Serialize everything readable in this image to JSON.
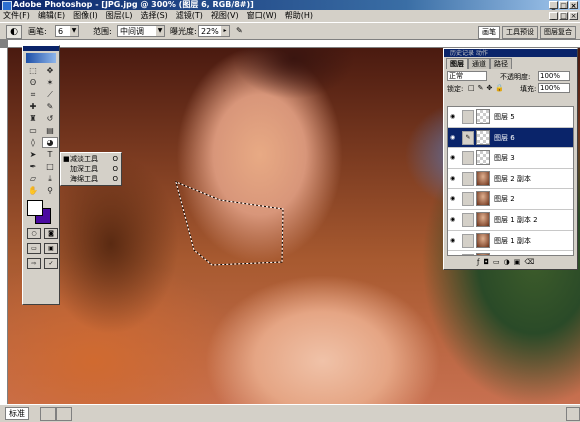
{
  "window": {
    "title": "Adobe Photoshop - [JPG.jpg @ 300% (图层 6, RGB/8#)]",
    "buttons": [
      "_",
      "□",
      "×"
    ]
  },
  "menu": [
    "文件(F)",
    "编辑(E)",
    "图像(I)",
    "图层(L)",
    "选择(S)",
    "滤镜(T)",
    "视图(V)",
    "窗口(W)",
    "帮助(H)"
  ],
  "options": {
    "brush_label": "画笔:",
    "brush_value": "6",
    "range_label": "范围:",
    "range_value": "中间调",
    "exposure_label": "曝光度:",
    "exposure_value": "22%"
  },
  "wells": [
    "画笔",
    "工具预设",
    "图层复合"
  ],
  "flyout": {
    "items": [
      {
        "bullet": "■",
        "label": "减淡工具",
        "key": "O"
      },
      {
        "bullet": "",
        "label": "加深工具",
        "key": "O"
      },
      {
        "bullet": "",
        "label": "海绵工具",
        "key": "O"
      }
    ]
  },
  "layers_panel": {
    "ghost_tabs": "历史记录 动作",
    "tabs": [
      "图层",
      "通道",
      "路径"
    ],
    "blend_mode": "正常",
    "opacity_label": "不透明度:",
    "opacity_value": "100%",
    "lock_label": "锁定:",
    "fill_label": "填充:",
    "fill_value": "100%",
    "layers": [
      {
        "name": "图层 5",
        "selected": false,
        "thumb": "transparent"
      },
      {
        "name": "图层 6",
        "selected": true,
        "thumb": "transparent"
      },
      {
        "name": "图层 3",
        "selected": false,
        "thumb": "transparent"
      },
      {
        "name": "图层 2 副本",
        "selected": false,
        "thumb": "photo"
      },
      {
        "name": "图层 2",
        "selected": false,
        "thumb": "photo"
      },
      {
        "name": "图层 1 副本 2",
        "selected": false,
        "thumb": "photo"
      },
      {
        "name": "图层 1 副本",
        "selected": false,
        "thumb": "photo"
      },
      {
        "name": "图层 1",
        "selected": false,
        "thumb": "photo"
      }
    ]
  },
  "status": {
    "mode": "标准"
  },
  "colors": {
    "titlebar": "#0a246a",
    "foreground": "#ffffff",
    "background": "#4a0aa0"
  }
}
